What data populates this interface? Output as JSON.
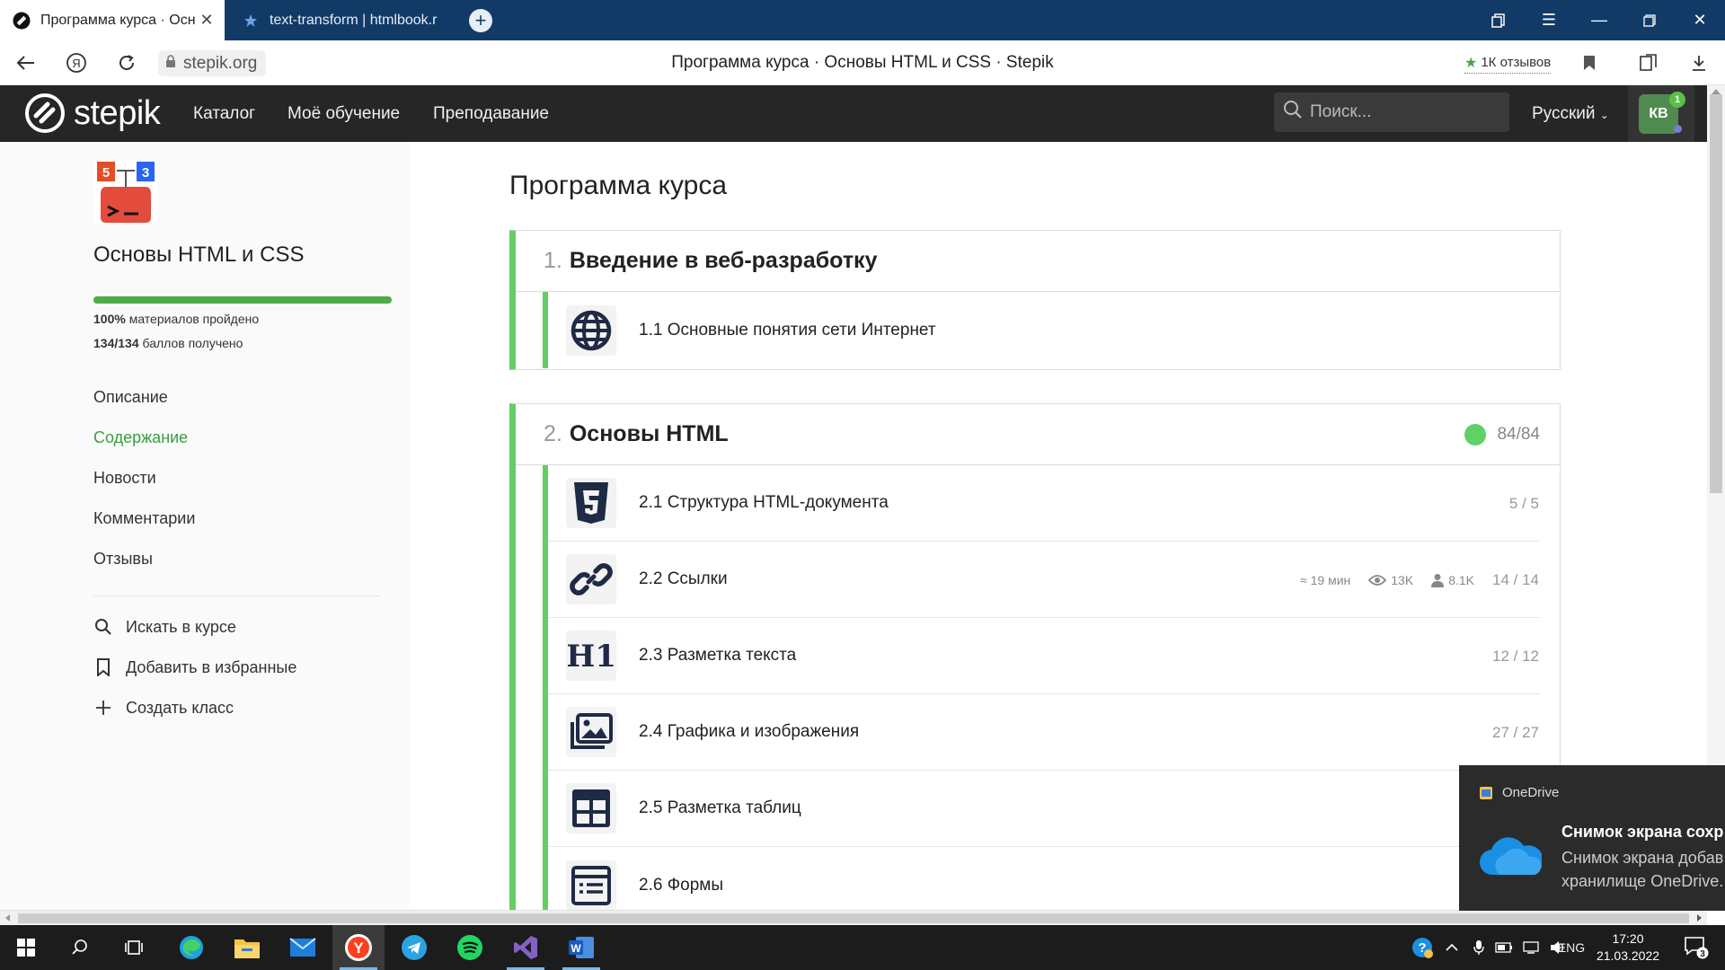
{
  "browser": {
    "tabs": [
      {
        "title": "Программа курса · Осн",
        "active": true,
        "icon": "stepik-favicon"
      },
      {
        "title": "text-transform | htmlbook.r",
        "active": false,
        "icon": "htmlbook-favicon"
      }
    ],
    "new_tab_label": "+",
    "address": {
      "domain": "stepik.org",
      "page_title": "Программа курса · Основы HTML и CSS · Stepik",
      "reviews_label": "1К отзывов"
    }
  },
  "header": {
    "logo_text": "stepik",
    "nav": [
      "Каталог",
      "Моё обучение",
      "Преподавание"
    ],
    "search_placeholder": "Поиск...",
    "language": "Русский",
    "avatar_initials": "КВ",
    "notification_count": "1"
  },
  "sidebar": {
    "course_title": "Основы HTML и CSS",
    "progress_fraction": 1.0,
    "materials_stat": {
      "bold": "100%",
      "text": " материалов пройдено"
    },
    "points_stat": {
      "bold": "134/134",
      "text": " баллов получено"
    },
    "links": [
      {
        "label": "Описание",
        "active": false
      },
      {
        "label": "Содержание",
        "active": true
      },
      {
        "label": "Новости",
        "active": false
      },
      {
        "label": "Комментарии",
        "active": false
      },
      {
        "label": "Отзывы",
        "active": false
      }
    ],
    "actions": [
      {
        "label": "Искать в курсе",
        "icon": "search-icon"
      },
      {
        "label": "Добавить в избранные",
        "icon": "bookmark-icon"
      },
      {
        "label": "Создать класс",
        "icon": "plus-icon"
      }
    ]
  },
  "main": {
    "title": "Программа курса",
    "modules": [
      {
        "num": "1.",
        "title": "Введение в веб-разработку",
        "lessons": [
          {
            "title": "1.1 Основные понятия сети Интернет",
            "icon": "globe-icon",
            "score": ""
          }
        ]
      },
      {
        "num": "2.",
        "title": "Основы HTML",
        "badge": "84/84",
        "lessons": [
          {
            "title": "2.1 Структура HTML-документа",
            "icon": "html5-icon",
            "score": "5 / 5"
          },
          {
            "title": "2.2 Ссылки",
            "icon": "link-icon",
            "score": "14 / 14",
            "time": "≈ 19 мин",
            "views": "13K",
            "learners": "8.1K"
          },
          {
            "title": "2.3 Разметка текста",
            "icon": "h1-icon",
            "score": "12 / 12"
          },
          {
            "title": "2.4 Графика и изображения",
            "icon": "images-icon",
            "score": "27 / 27"
          },
          {
            "title": "2.5 Разметка таблиц",
            "icon": "table-icon",
            "score": ""
          },
          {
            "title": "2.6 Формы",
            "icon": "form-icon",
            "score": ""
          }
        ]
      }
    ]
  },
  "toast": {
    "app": "OneDrive",
    "title": "Снимок экрана сохр",
    "body_line1": "Снимок экрана добав",
    "body_line2": "хранилище OneDrive."
  },
  "taskbar": {
    "language": "ENG",
    "time": "17:20",
    "date": "21.03.2022",
    "notifications_count": "3"
  },
  "colors": {
    "tabstrip": "#123a66",
    "stepik_header": "#262626",
    "accent_green": "#66cc66",
    "active_link": "#389e3f",
    "icon_navy": "#1f2a44"
  }
}
